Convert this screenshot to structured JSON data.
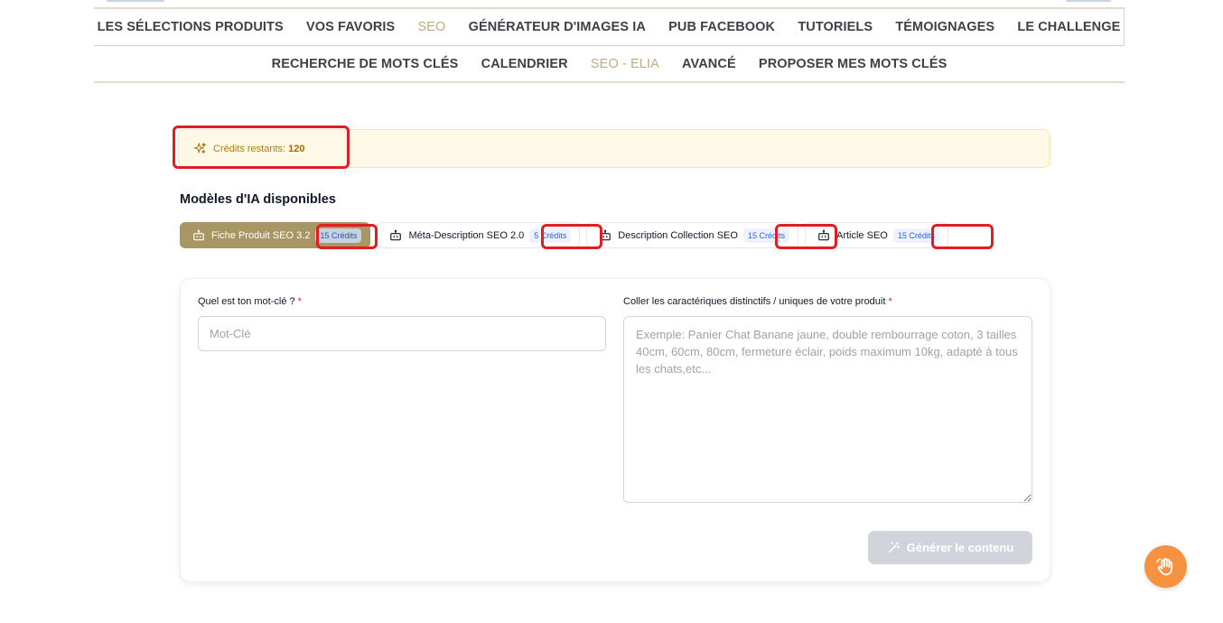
{
  "nav": {
    "main": [
      {
        "label": "LES SÉLECTIONS PRODUITS",
        "active": false
      },
      {
        "label": "VOS FAVORIS",
        "active": false
      },
      {
        "label": "SEO",
        "active": true
      },
      {
        "label": "GÉNÉRATEUR D'IMAGES IA",
        "active": false
      },
      {
        "label": "PUB FACEBOOK",
        "active": false
      },
      {
        "label": "TUTORIELS",
        "active": false
      },
      {
        "label": "TÉMOIGNAGES",
        "active": false
      },
      {
        "label": "LE CHALLENGE",
        "active": false
      }
    ],
    "sub": [
      {
        "label": "RECHERCHE DE MOTS CLÉS",
        "active": false
      },
      {
        "label": "CALENDRIER",
        "active": false
      },
      {
        "label": "SEO - ELIA",
        "active": true
      },
      {
        "label": "AVANCÉ",
        "active": false
      },
      {
        "label": "PROPOSER MES MOTS CLÉS",
        "active": false
      }
    ]
  },
  "credits": {
    "label": "Crédits restants:",
    "value": "120",
    "icon": "sparkles-icon",
    "color": "#b07d12"
  },
  "models": {
    "title": "Modèles d'IA disponibles",
    "tabs": [
      {
        "label": "Fiche Produit SEO 3.2",
        "badge": "15 Crédits",
        "active": true,
        "icon": "robot-icon"
      },
      {
        "label": "Méta-Description SEO 2.0",
        "badge": "5 Crédits",
        "active": false,
        "icon": "robot-icon"
      },
      {
        "label": "Description Collection SEO",
        "badge": "15 Crédits",
        "active": false,
        "icon": "robot-icon"
      },
      {
        "label": "Article SEO",
        "badge": "15 Crédits",
        "active": false,
        "icon": "robot-icon"
      }
    ]
  },
  "form": {
    "keyword_label": "Quel est ton mot-clé ?",
    "keyword_placeholder": "Mot-Clé",
    "keyword_value": "",
    "features_label": "Coller les caractériques distinctifs / uniques de votre produit",
    "features_placeholder": "Exemple: Panier Chat Banane jaune, double rembourrage coton, 3 tailles 40cm, 60cm, 80cm, fermeture éclair, poids maximum 10kg, adapté à tous les chats,etc...",
    "features_value": "",
    "required_mark": "*",
    "generate_label": "Générer le contenu",
    "generate_icon": "magic-wand-icon"
  },
  "help": {
    "icon": "waving-hand-icon"
  },
  "colors": {
    "accent": "#a89664",
    "nav_active": "#c3ab7f",
    "highlight": "#e11d21",
    "badge_text": "#2563eb",
    "help_fab": "#f6923f"
  }
}
